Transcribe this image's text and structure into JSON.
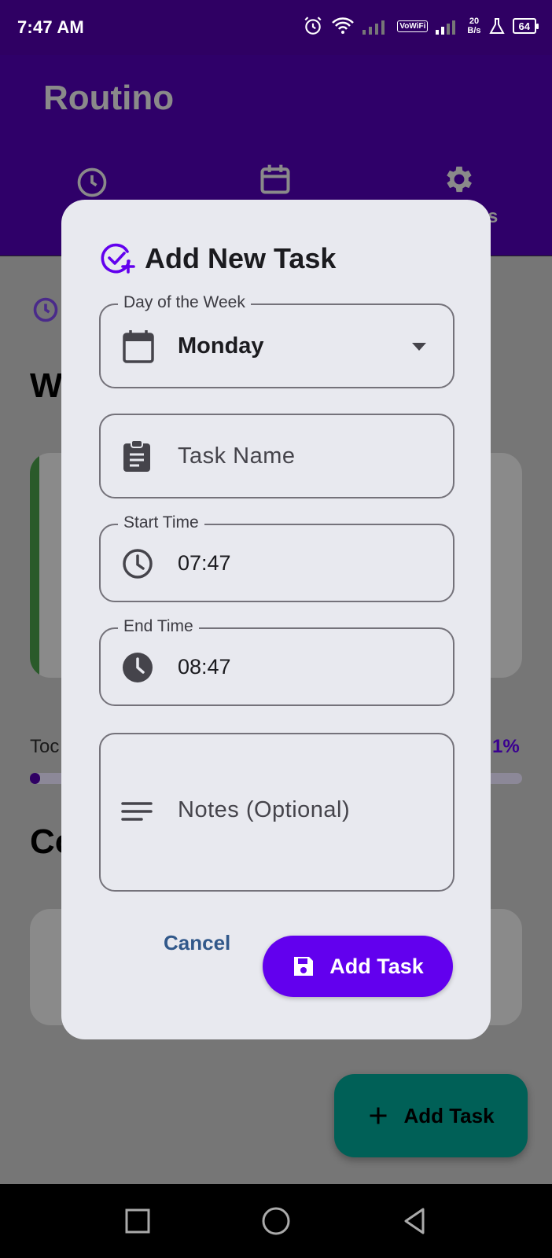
{
  "status_bar": {
    "time": "7:47 AM",
    "vowifi_label": "VoWiFi",
    "net_speed_value": "20",
    "net_speed_unit": "B/s",
    "battery": "64"
  },
  "app": {
    "title": "Routino",
    "tabs": [
      {
        "icon": "clock-icon"
      },
      {
        "icon": "calendar-icon"
      },
      {
        "icon": "gear-icon",
        "label_partial": "s"
      }
    ]
  },
  "background": {
    "heading_partial": "W",
    "today_partial": "Toc",
    "percent_partial": "1%",
    "progress_fraction": 0.02,
    "heading2_partial": "Co",
    "fab_label": "Add Task"
  },
  "dialog": {
    "title": "Add New Task",
    "fields": {
      "day": {
        "label": "Day of the Week",
        "value": "Monday"
      },
      "task_name": {
        "placeholder": "Task Name"
      },
      "start_time": {
        "label": "Start Time",
        "value": "07:47"
      },
      "end_time": {
        "label": "End Time",
        "value": "08:47"
      },
      "notes": {
        "placeholder": "Notes (Optional)"
      }
    },
    "cancel_label": "Cancel",
    "submit_label": "Add Task"
  },
  "colors": {
    "app_bar": "#2f0063",
    "primary": "#6200ee",
    "fab": "#006057",
    "dialog_bg": "#e8e9ef"
  }
}
